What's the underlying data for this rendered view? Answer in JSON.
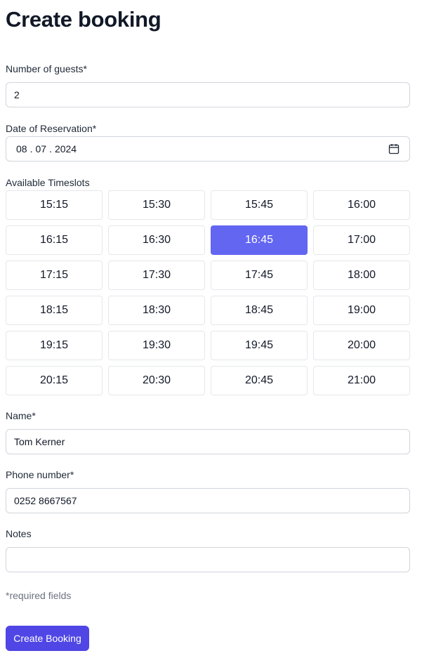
{
  "page": {
    "title": "Create booking"
  },
  "guests": {
    "label": "Number of guests*",
    "value": "2"
  },
  "date": {
    "label": "Date of Reservation*",
    "day": "08",
    "month": "07",
    "year": "2024",
    "separator": ".",
    "icon": "calendar-icon"
  },
  "timeslots": {
    "label": "Available Timeslots",
    "selected": "16:45",
    "slots": [
      "15:15",
      "15:30",
      "15:45",
      "16:00",
      "16:15",
      "16:30",
      "16:45",
      "17:00",
      "17:15",
      "17:30",
      "17:45",
      "18:00",
      "18:15",
      "18:30",
      "18:45",
      "19:00",
      "19:15",
      "19:30",
      "19:45",
      "20:00",
      "20:15",
      "20:30",
      "20:45",
      "21:00"
    ]
  },
  "name": {
    "label": "Name*",
    "value": "Tom Kerner"
  },
  "phone": {
    "label": "Phone number*",
    "value": "0252 8667567"
  },
  "notes": {
    "label": "Notes",
    "value": ""
  },
  "footer": {
    "required_hint": "*required fields",
    "submit_label": "Create Booking"
  },
  "colors": {
    "accent": "#6366f1",
    "button": "#4f46e5",
    "border": "#d1d5db",
    "muted_text": "#6b7280"
  }
}
